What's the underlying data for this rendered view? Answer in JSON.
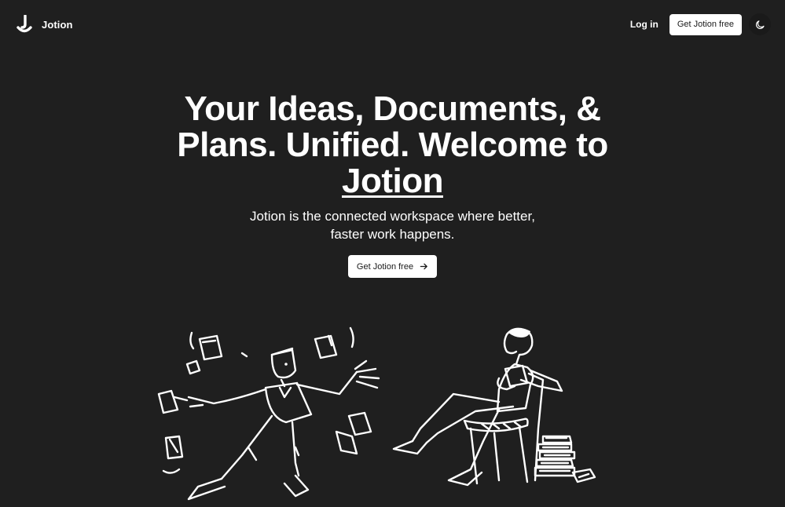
{
  "nav": {
    "logo_text": "Jotion",
    "login_label": "Log in",
    "signup_label": "Get Jotion free",
    "theme_icon": "moon-icon"
  },
  "hero": {
    "headline_part1": "Your Ideas, Documents, & Plans. Unified. Welcome to ",
    "headline_brand": "Jotion",
    "subhead": "Jotion is the connected workspace where better, faster work happens.",
    "cta_label": "Get Jotion free",
    "cta_icon": "arrow-right-icon"
  },
  "illustrations": {
    "left": "juggling-documents-illustration",
    "right": "reading-person-illustration"
  },
  "colors": {
    "background": "#1f1f1f",
    "text": "#ffffff",
    "button_bg": "#ffffff",
    "button_text": "#1a1a1a"
  }
}
